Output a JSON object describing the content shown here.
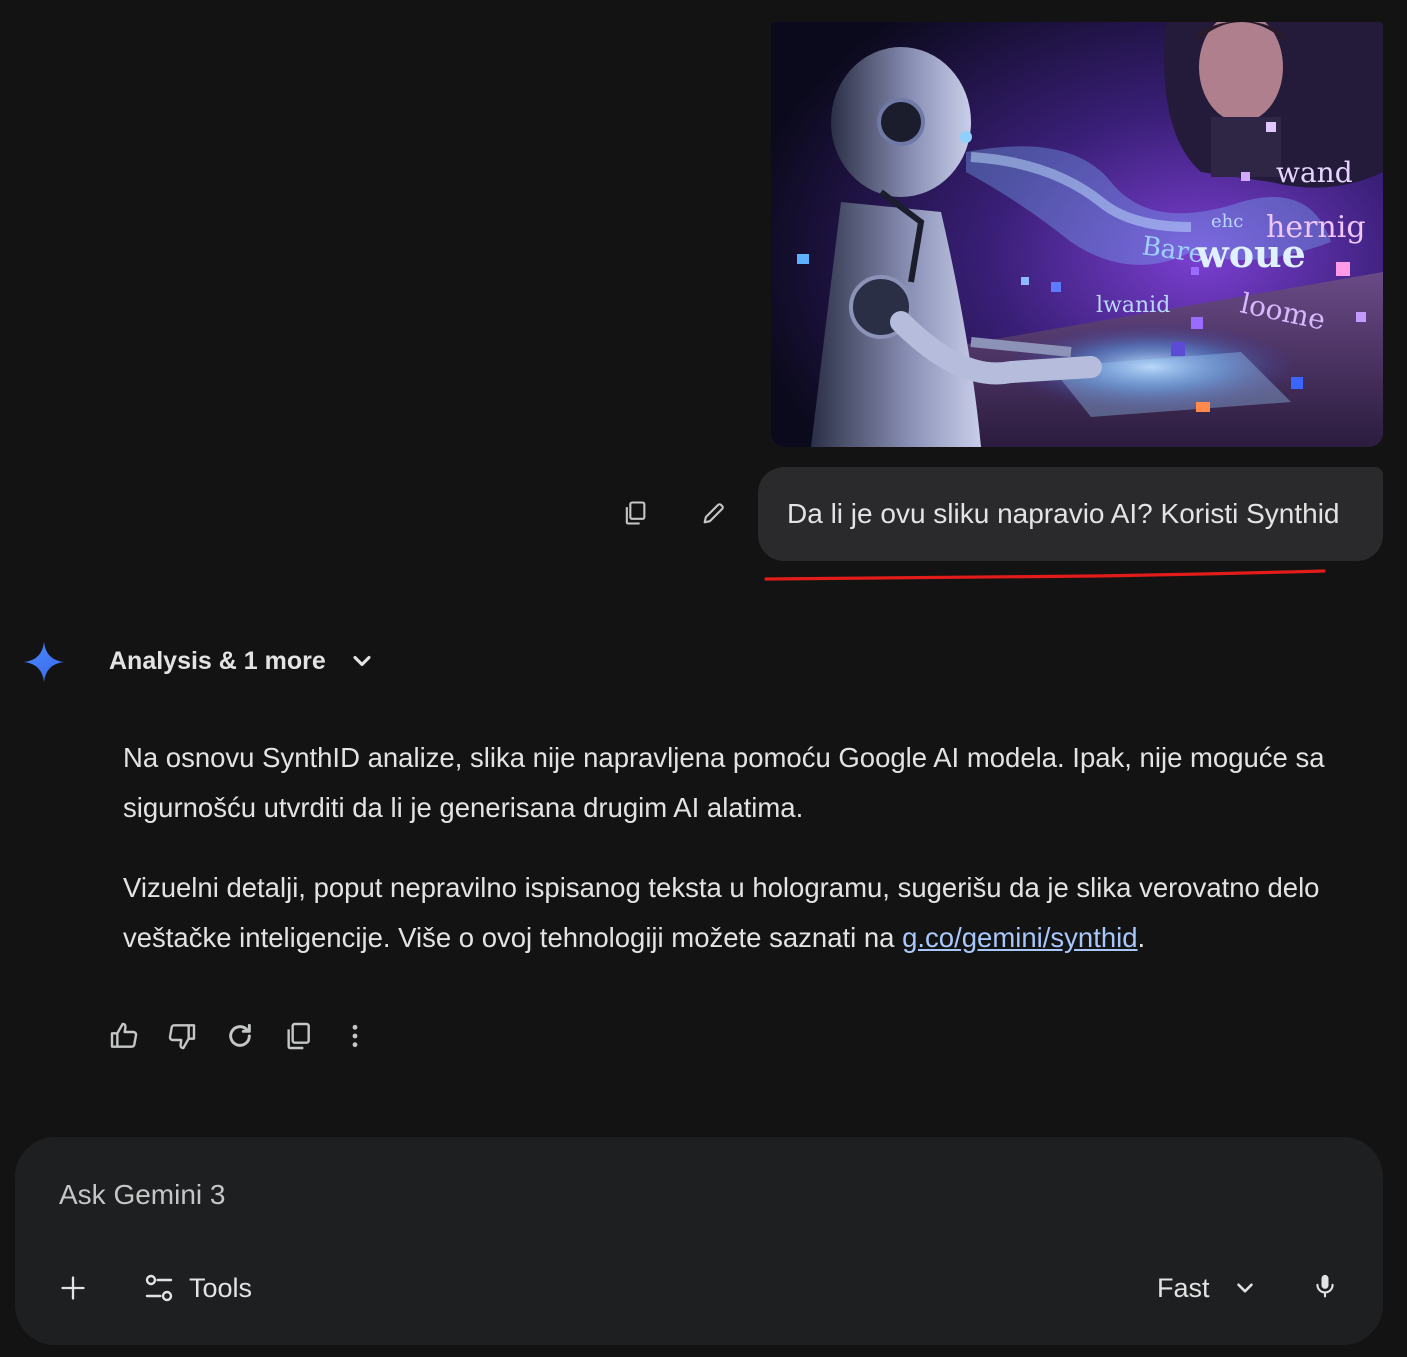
{
  "user_message": {
    "image": {
      "alt": "humanoid robot typing while glowing holographic words rise from a keyboard",
      "hologram_words": [
        "wand",
        "hernig",
        "Bare",
        "woue",
        "loome",
        "lwanid",
        "ehc"
      ]
    },
    "text": "Da li je ovu sliku napravio AI? Koristi Synthid",
    "copy_icon": "copy-icon",
    "edit_icon": "pencil-icon"
  },
  "response": {
    "model_toggle_label": "Analysis & 1 more",
    "paragraph_1": "Na osnovu SynthID analize, slika nije napravljena pomoću Google AI modela. Ipak, nije moguće sa sigurnošću utvrditi da li je generisana drugim AI alatima.",
    "paragraph_2_text": "Vizuelni detalji, poput nepravilno ispisanog teksta u hologramu, sugerišu da je slika verovatno delo veštačke inteligencije. Više o ovoj tehnologiji možete saznati na ",
    "paragraph_2_link": "g.co/gemini/synthid",
    "paragraph_2_end": ".",
    "actions": [
      "thumbs-up-icon",
      "thumbs-down-icon",
      "redo-icon",
      "copy-icon",
      "more-vert-icon"
    ]
  },
  "composer": {
    "placeholder": "Ask Gemini 3",
    "tools_label": "Tools",
    "mode_label": "Fast"
  },
  "colors": {
    "background": "#131314",
    "bubble": "#2a2a2c",
    "composer": "#1e1f20",
    "link": "#a8c7fa",
    "annotation_red": "#e21b1b"
  }
}
